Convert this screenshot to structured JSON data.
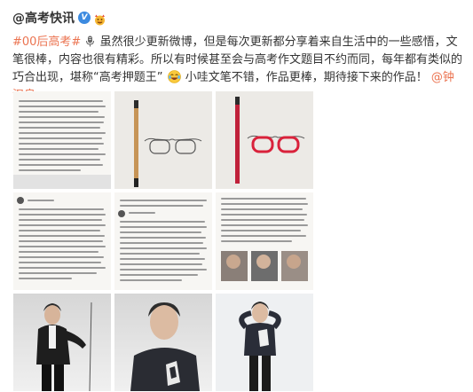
{
  "post": {
    "author": "@高考快讯",
    "text": {
      "topic": "#00后高考#",
      "part1": "虽然很少更新微博，但是每次更新都分享着来自生活中的一些感悟，文笔很棒，内容也很有精彩。所以有时候甚至会与高考作文题目不约而同，每年都有类似的巧合出现，堪称“高考押题王”",
      "part2": "小哇文笔不错，作品更棒，期待接下来的作品！",
      "mention": "@钟汉良"
    },
    "icons": {
      "verified": "verified-v-badge",
      "hot": "hot-flame-icon",
      "mic": "microphone-icon",
      "emoji": "laughing-tears-emoji"
    }
  },
  "colors": {
    "link_orange": "#eb7350",
    "link_blue": "#3a7fc1",
    "verified_blue": "#3d8be0",
    "text": "#333333"
  },
  "images": [
    {
      "name": "image-1",
      "kind": "text-screenshot"
    },
    {
      "name": "image-2",
      "kind": "glasses-sketch-pencil"
    },
    {
      "name": "image-3",
      "kind": "glasses-sketch-red-pencil"
    },
    {
      "name": "image-4",
      "kind": "text-screenshot"
    },
    {
      "name": "image-5",
      "kind": "text-screenshot"
    },
    {
      "name": "image-6",
      "kind": "text-screenshot-with-photos"
    },
    {
      "name": "image-7",
      "kind": "photo-man-black-jacket"
    },
    {
      "name": "image-8",
      "kind": "photo-man-sweater-closeup"
    },
    {
      "name": "image-9",
      "kind": "photo-man-heart-hands"
    }
  ]
}
